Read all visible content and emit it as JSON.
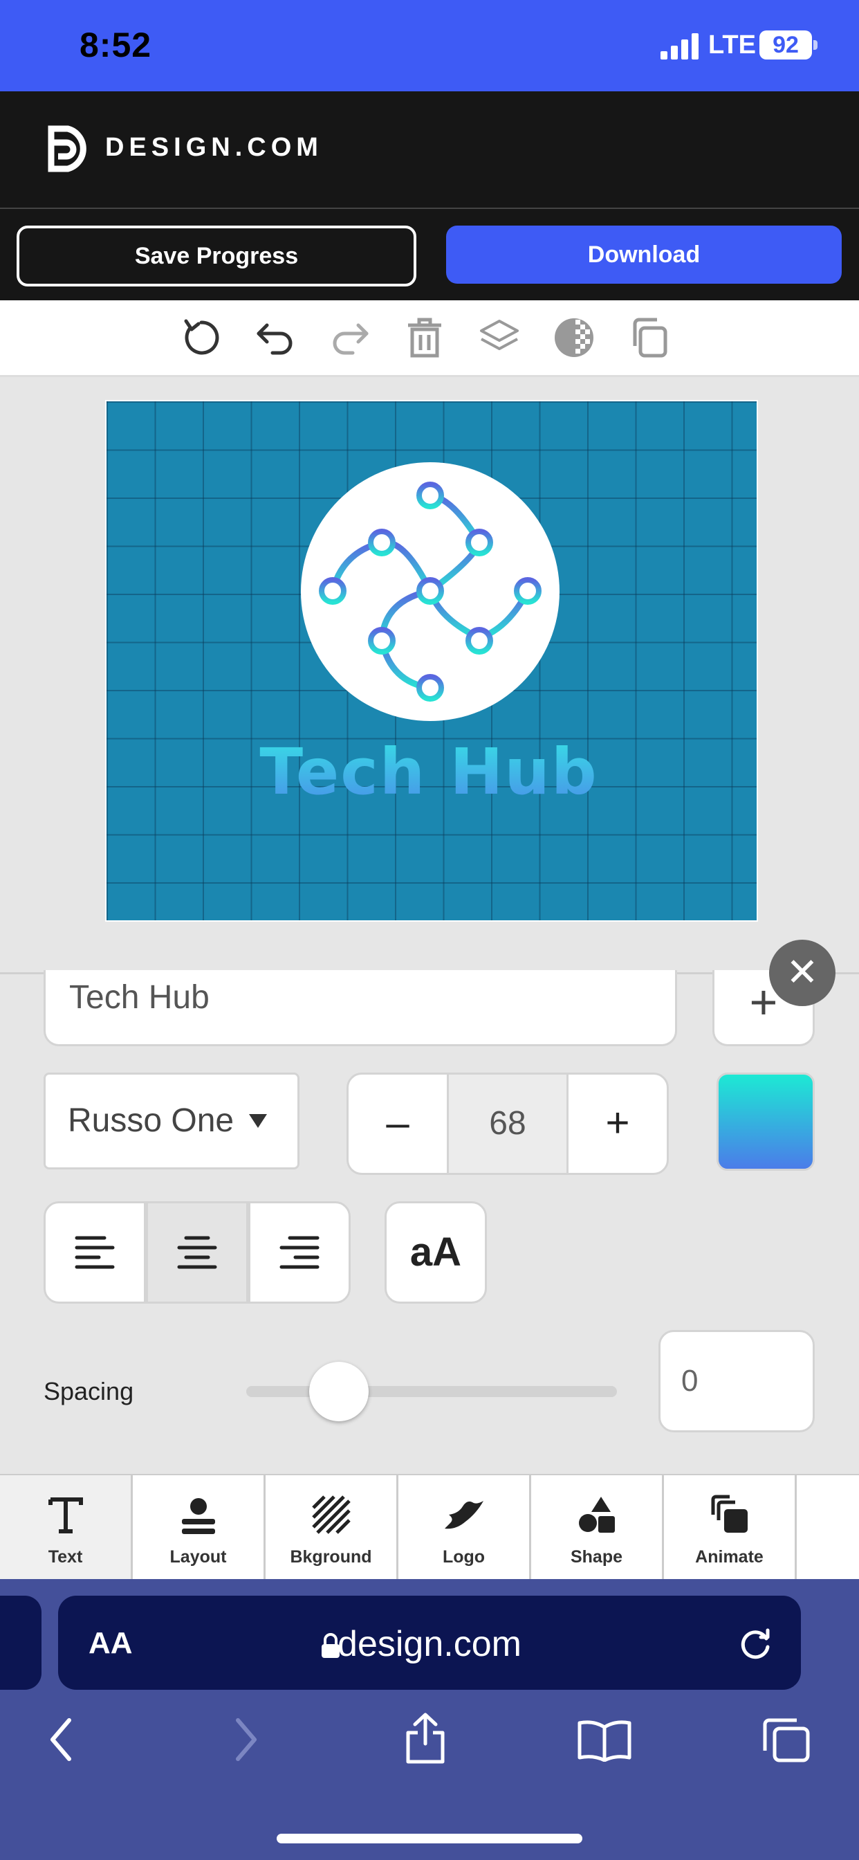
{
  "status_bar": {
    "time": "8:52",
    "network": "LTE",
    "battery": "92"
  },
  "header": {
    "brand": "DESIGN.COM"
  },
  "actions": {
    "save_label": "Save Progress",
    "download_label": "Download"
  },
  "toolbar": {
    "tools": [
      "reset-icon",
      "undo-icon",
      "redo-icon",
      "trash-icon",
      "layers-icon",
      "transparency-icon",
      "duplicate-icon"
    ]
  },
  "canvas": {
    "title": "Tech Hub",
    "background_color": "#1b87b0",
    "text_gradient": [
      "#37e0e6",
      "#4a8fe8"
    ]
  },
  "text_panel": {
    "text_value": "Tech Hub",
    "add_symbol": "+",
    "font": "Russo One",
    "size_minus": "–",
    "font_size": "68",
    "size_plus": "+",
    "case_toggle": "aA",
    "spacing_label": "Spacing",
    "spacing_value": "0",
    "spacing_level": 0.25,
    "close_symbol": "✕"
  },
  "tabs": [
    {
      "label": "Text",
      "icon": "text-icon"
    },
    {
      "label": "Layout",
      "icon": "layout-icon"
    },
    {
      "label": "Bkground",
      "icon": "background-icon"
    },
    {
      "label": "Logo",
      "icon": "logo-icon"
    },
    {
      "label": "Shape",
      "icon": "shape-icon"
    },
    {
      "label": "Animate",
      "icon": "animate-icon"
    }
  ],
  "browser": {
    "aa_label": "AA",
    "url": "design.com"
  },
  "colors": {
    "accent": "#3e5bf5",
    "header_bg": "#161616",
    "browser_bg": "#44509a",
    "urlbar_bg": "#0c1552"
  }
}
